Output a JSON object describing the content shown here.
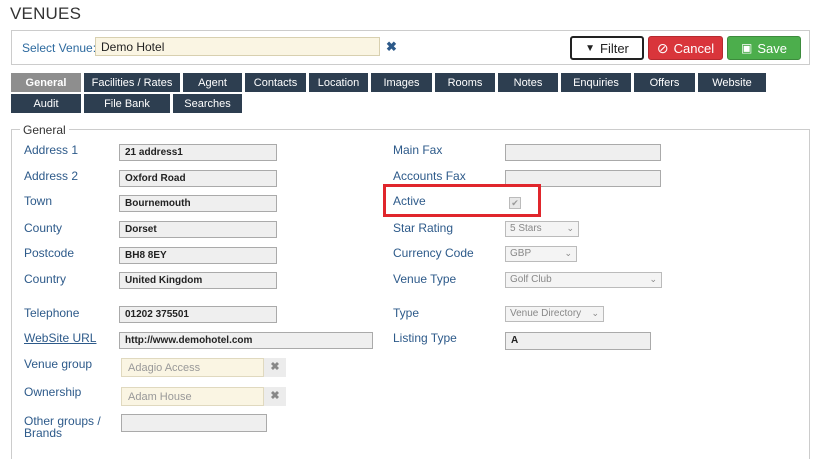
{
  "page": {
    "title": "VENUES"
  },
  "venue_bar": {
    "label": "Select Venue:",
    "value": "Demo Hotel",
    "clear_glyph": "✖"
  },
  "buttons": {
    "filter": {
      "label": "Filter",
      "icon": "filter-icon",
      "glyph": "▼"
    },
    "cancel": {
      "label": "Cancel",
      "icon": "ban-icon",
      "glyph": "⊘"
    },
    "save": {
      "label": "Save",
      "icon": "floppy-disk-icon",
      "glyph": "▣"
    }
  },
  "tabs": {
    "row1": [
      "General",
      "Facilities / Rates",
      "Agent",
      "Contacts",
      "Location",
      "Images",
      "Rooms",
      "Notes",
      "Enquiries",
      "Offers",
      "Website"
    ],
    "row2": [
      "Audit",
      "File Bank",
      "Searches"
    ],
    "active": "General"
  },
  "general": {
    "legend": "General",
    "address1": {
      "label": "Address 1",
      "value": "21 address1"
    },
    "address2": {
      "label": "Address 2",
      "value": "Oxford Road"
    },
    "town": {
      "label": "Town",
      "value": "Bournemouth"
    },
    "county": {
      "label": "County",
      "value": "Dorset"
    },
    "postcode": {
      "label": "Postcode",
      "value": "BH8 8EY"
    },
    "country": {
      "label": "Country",
      "value": "United Kingdom"
    },
    "telephone": {
      "label": "Telephone",
      "value": "01202 375501"
    },
    "website": {
      "label": "WebSite URL",
      "value": "http://www.demohotel.com"
    },
    "venue_group": {
      "label": "Venue group",
      "value": "Adagio Access"
    },
    "ownership": {
      "label": "Ownership",
      "value": "Adam House"
    },
    "other_groups": {
      "label_line1": "Other groups /",
      "label_line2": "Brands",
      "value": ""
    },
    "main_fax": {
      "label": "Main Fax",
      "value": ""
    },
    "accounts_fax": {
      "label": "Accounts Fax",
      "value": ""
    },
    "active": {
      "label": "Active",
      "checked": true,
      "check_glyph": "✔"
    },
    "star_rating": {
      "label": "Star Rating",
      "value": "5 Stars"
    },
    "currency_code": {
      "label": "Currency Code",
      "value": "GBP"
    },
    "venue_type": {
      "label": "Venue Type",
      "value": "Golf Club"
    },
    "type": {
      "label": "Type",
      "value": "Venue Directory"
    },
    "listing_type": {
      "label": "Listing Type",
      "value": "A"
    },
    "pill_clear_glyph": "✖",
    "select_chevron_glyph": "⌄"
  },
  "colors": {
    "tab_bg": "#2d3e50",
    "tab_active_bg": "#8e8e8e",
    "label_blue": "#2d5a8a",
    "cancel_red": "#d9353b",
    "save_green": "#4cae4c",
    "highlight_red": "#e0262c",
    "venue_input_bg": "#faf5e3"
  }
}
